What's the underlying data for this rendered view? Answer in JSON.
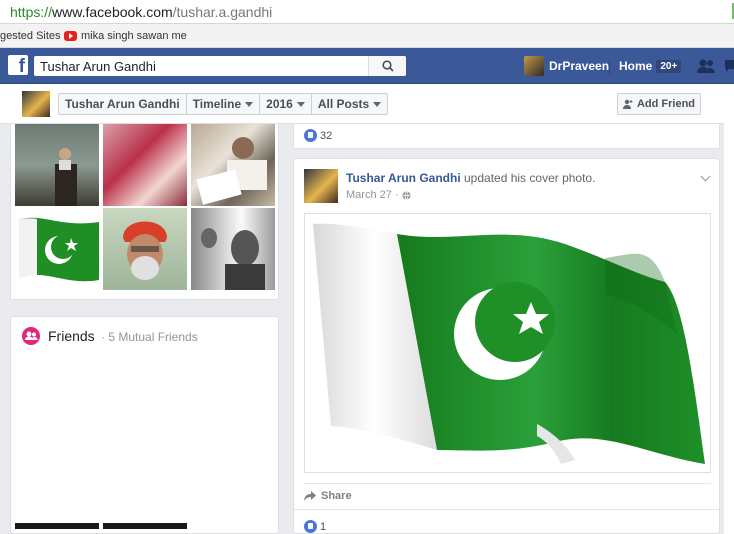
{
  "browser": {
    "url_scheme": "https://",
    "url_host": "www.facebook.com",
    "url_path": "/tushar.a.gandhi",
    "bookmarks": [
      "gested Sites",
      "mika singh sawan me"
    ]
  },
  "topbar": {
    "search_value": "Tushar Arun Gandhi",
    "user_name": "DrPraveen",
    "home_label": "Home",
    "home_badge": "20+"
  },
  "subnav": {
    "profile_name": "Tushar Arun Gandhi",
    "crumbs": [
      "Timeline",
      "2016",
      "All Posts"
    ],
    "add_friend": "Add Friend"
  },
  "friends": {
    "title": "Friends",
    "mutual": "· 5 Mutual Friends"
  },
  "post_prev": {
    "likes": "32"
  },
  "post": {
    "author": "Tushar Arun Gandhi",
    "action": " updated his cover photo.",
    "date": "March 27 · ",
    "share_label": "Share",
    "likes": "1"
  },
  "colors": {
    "fb_blue": "#3b5998",
    "flag_green": "#1e8a24"
  }
}
